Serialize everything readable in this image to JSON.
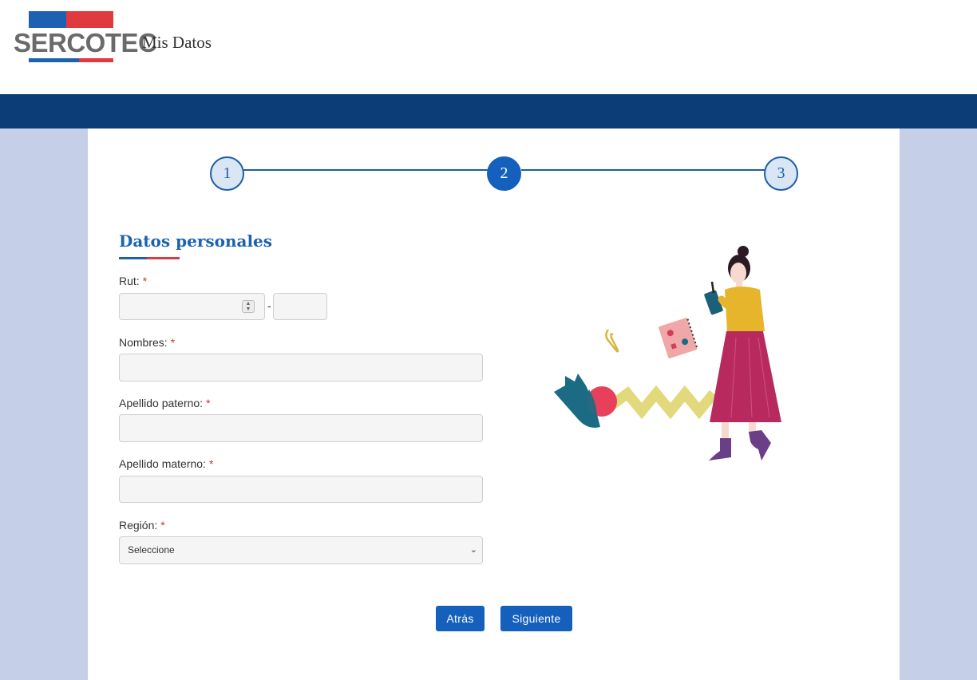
{
  "header": {
    "logo_text": "SERCOTEC",
    "app_title": "Mis Datos"
  },
  "stepper": {
    "steps": [
      "1",
      "2",
      "3"
    ],
    "active_step": 2
  },
  "form": {
    "section_title": "Datos personales",
    "required_mark": "*",
    "rut": {
      "label": "Rut:",
      "separator": "-",
      "value": "",
      "dv_value": ""
    },
    "nombres": {
      "label": "Nombres:",
      "value": ""
    },
    "apellido_paterno": {
      "label": "Apellido paterno:",
      "value": ""
    },
    "apellido_materno": {
      "label": "Apellido materno:",
      "value": ""
    },
    "region": {
      "label": "Región:",
      "selected": "Seleccione"
    }
  },
  "buttons": {
    "back": "Atrás",
    "next": "Siguiente"
  },
  "colors": {
    "brand_blue": "#1560bd",
    "navy_band": "#0c3d76",
    "brand_red": "#e0393e",
    "background": "#c5cfe8"
  },
  "icons": [
    "spin-arrows-icon",
    "chevron-down-icon",
    "woman-with-notebook-illustration"
  ]
}
